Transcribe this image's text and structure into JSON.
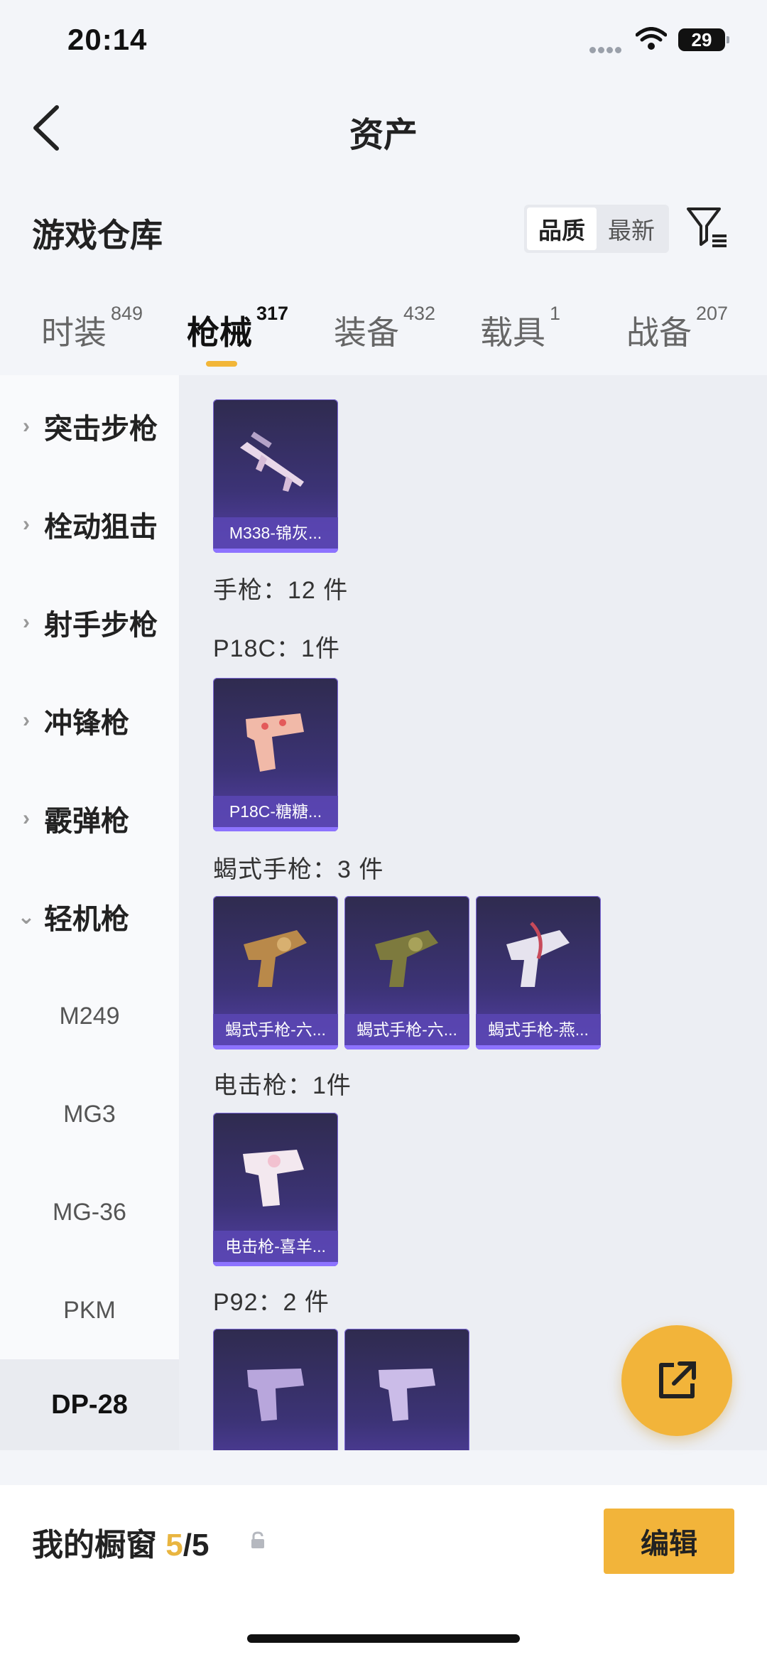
{
  "status": {
    "time": "20:14",
    "battery": "29"
  },
  "header": {
    "title": "资产"
  },
  "warehouse": {
    "title": "游戏仓库",
    "sort": [
      "品质",
      "最新"
    ],
    "icons": {
      "back": "back-arrow-icon",
      "filter": "filter-icon"
    }
  },
  "tabs": [
    {
      "label": "时装",
      "count": "849"
    },
    {
      "label": "枪械",
      "count": "317"
    },
    {
      "label": "装备",
      "count": "432"
    },
    {
      "label": "载具",
      "count": "1"
    },
    {
      "label": "战备",
      "count": "207"
    }
  ],
  "sidebar": {
    "categories": [
      "突击步枪",
      "栓动狙击",
      "射手步枪",
      "冲锋枪",
      "霰弹枪",
      "轻机枪"
    ],
    "subitems": [
      "M249",
      "MG3",
      "MG-36",
      "PKM",
      "DP-28"
    ]
  },
  "content": {
    "group_m338": {
      "cards": [
        "M338-锦灰..."
      ]
    },
    "pistol_header": "手枪：12 件",
    "p18c": {
      "label": "P18C：1件",
      "cards": [
        "P18C-糖糖..."
      ]
    },
    "scorpion": {
      "label": "蝎式手枪：3 件",
      "cards": [
        "蝎式手枪-六...",
        "蝎式手枪-六...",
        "蝎式手枪-燕..."
      ]
    },
    "stun": {
      "label": "电击枪：1件",
      "cards": [
        "电击枪-喜羊..."
      ]
    },
    "p92": {
      "label": "P92：2 件"
    }
  },
  "showcase": {
    "title": "我的橱窗",
    "current": "5",
    "total": "/5",
    "edit_label": "编辑"
  },
  "colors": {
    "accent": "#f2b43a",
    "card_bg": "#3c3376"
  }
}
